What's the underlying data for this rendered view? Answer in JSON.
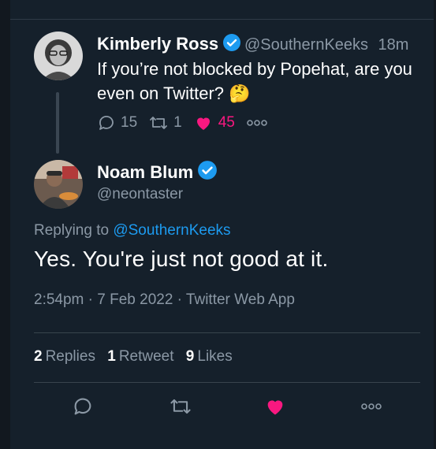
{
  "quoted_tweet": {
    "name": "Kimberly Ross",
    "handle": "@SouthernKeeks",
    "time": "18m",
    "text": "If you’re not blocked by Popehat, are you even on Twitter?",
    "emoji": "🤔",
    "replies": "15",
    "retweets": "1",
    "likes": "45"
  },
  "tweet": {
    "name": "Noam Blum",
    "handle": "@neontaster",
    "replying_prefix": "Replying to",
    "replying_to": "@SouthernKeeks",
    "text": "Yes. You're just not good at it.",
    "timestamp": "2:54pm · 7 Feb 2022 · Twitter Web App"
  },
  "stats": {
    "replies_count": "2",
    "replies_label": "Replies",
    "retweets_count": "1",
    "retweets_label": "Retweet",
    "likes_count": "9",
    "likes_label": "Likes"
  },
  "colors": {
    "background": "#15202b",
    "accent": "#1d9bf0",
    "like": "#f91880",
    "muted": "#8b98a5"
  },
  "icons": {
    "reply": "reply-icon",
    "retweet": "retweet-icon",
    "like": "heart-icon",
    "more": "more-icon",
    "verified": "verified-badge-icon"
  }
}
